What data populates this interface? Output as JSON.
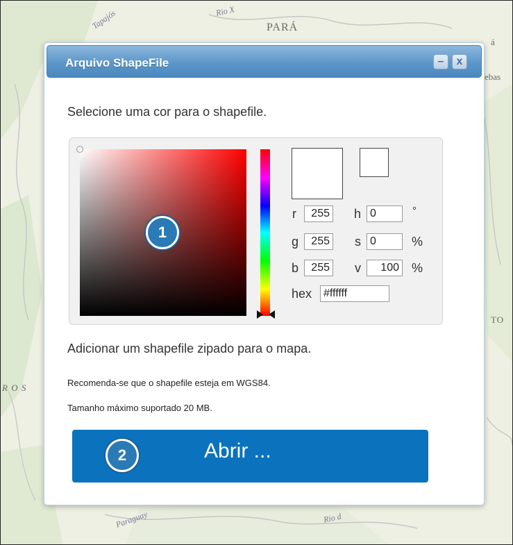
{
  "map": {
    "labels": {
      "para": "PARÁ",
      "tapajos": "Tapajós",
      "rio_top": "Rio X",
      "macapa_frag": "á",
      "ebas_frag": "ebas",
      "to_frag": "TO",
      "ros_frag": "R O S",
      "paraguay": "Paraguay",
      "rio_bottom": "Rio d"
    }
  },
  "dialog": {
    "title": "Arquivo ShapeFile",
    "minimize_label": "–",
    "close_label": "x",
    "select_color_text": "Selecione uma cor para o shapefile.",
    "color_picker": {
      "r_label": "r",
      "r_value": "255",
      "g_label": "g",
      "g_value": "255",
      "b_label": "b",
      "b_value": "255",
      "h_label": "h",
      "h_value": "0",
      "h_unit": "°",
      "s_label": "s",
      "s_value": "0",
      "s_unit": "%",
      "v_label": "v",
      "v_value": "100",
      "v_unit": "%",
      "hex_label": "hex",
      "hex_value": "#ffffff",
      "current_color": "#ffffff",
      "original_color": "#ffffff"
    },
    "marker_1": "1",
    "add_shapefile_text": "Adicionar um shapefile zipado para o mapa.",
    "recommend_text": "Recomenda-se que o shapefile esteja em WGS84.",
    "max_size_text": "Tamanho máximo suportado 20 MB.",
    "marker_2": "2",
    "open_button_label": "Abrir ..."
  },
  "colors": {
    "titlebar": "#5c97c9",
    "button": "#0b73bd",
    "marker": "#2a7ab5"
  }
}
